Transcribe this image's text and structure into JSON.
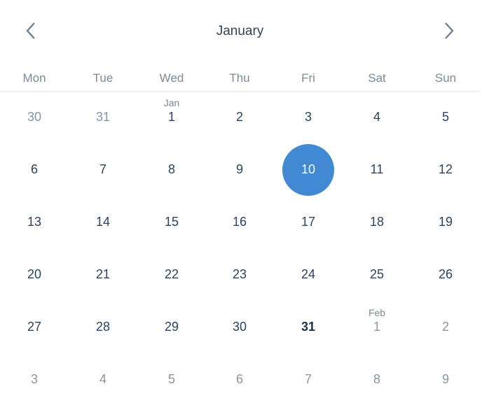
{
  "header": {
    "title": "January",
    "prev_icon": "chevron-left-icon",
    "next_icon": "chevron-right-icon"
  },
  "colors": {
    "accent": "#4189d3",
    "text_primary": "#2b4360",
    "text_muted": "#8a96a3"
  },
  "weekdays": [
    "Mon",
    "Tue",
    "Wed",
    "Thu",
    "Fri",
    "Sat",
    "Sun"
  ],
  "weeks": [
    [
      {
        "day": "30",
        "outside": true
      },
      {
        "day": "31",
        "outside": true
      },
      {
        "day": "1",
        "month_label": "Jan"
      },
      {
        "day": "2"
      },
      {
        "day": "3"
      },
      {
        "day": "4"
      },
      {
        "day": "5"
      }
    ],
    [
      {
        "day": "6"
      },
      {
        "day": "7"
      },
      {
        "day": "8"
      },
      {
        "day": "9"
      },
      {
        "day": "10",
        "selected": true
      },
      {
        "day": "11"
      },
      {
        "day": "12"
      }
    ],
    [
      {
        "day": "13"
      },
      {
        "day": "14"
      },
      {
        "day": "15"
      },
      {
        "day": "16"
      },
      {
        "day": "17"
      },
      {
        "day": "18"
      },
      {
        "day": "19"
      }
    ],
    [
      {
        "day": "20"
      },
      {
        "day": "21"
      },
      {
        "day": "22"
      },
      {
        "day": "23"
      },
      {
        "day": "24"
      },
      {
        "day": "25"
      },
      {
        "day": "26"
      }
    ],
    [
      {
        "day": "27"
      },
      {
        "day": "28"
      },
      {
        "day": "29"
      },
      {
        "day": "30"
      },
      {
        "day": "31",
        "today": true
      },
      {
        "day": "1",
        "outside": true,
        "month_label": "Feb"
      },
      {
        "day": "2",
        "outside": true
      }
    ],
    [
      {
        "day": "3",
        "outside": true
      },
      {
        "day": "4",
        "outside": true
      },
      {
        "day": "5",
        "outside": true
      },
      {
        "day": "6",
        "outside": true
      },
      {
        "day": "7",
        "outside": true
      },
      {
        "day": "8",
        "outside": true
      },
      {
        "day": "9",
        "outside": true
      }
    ]
  ]
}
